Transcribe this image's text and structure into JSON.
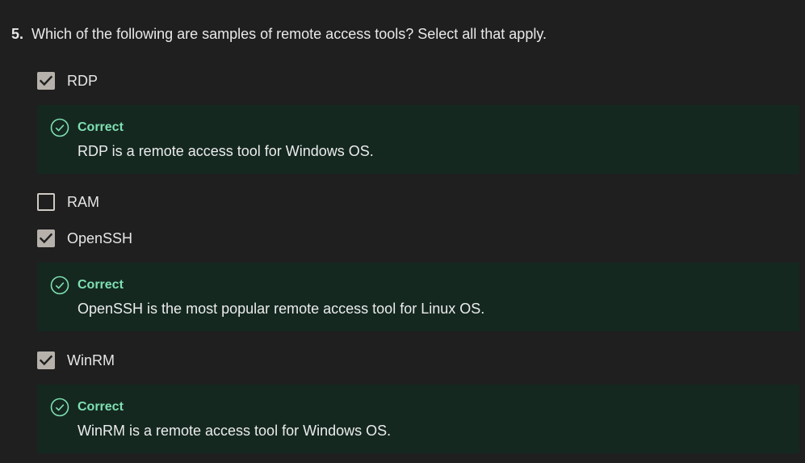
{
  "question": {
    "number": "5.",
    "text": "Which of the following are samples of remote access tools? Select all that apply."
  },
  "options": [
    {
      "label": "RDP",
      "checked": true,
      "feedback": {
        "status": "Correct",
        "text": "RDP is a remote access tool for Windows OS."
      }
    },
    {
      "label": "RAM",
      "checked": false
    },
    {
      "label": "OpenSSH",
      "checked": true,
      "feedback": {
        "status": "Correct",
        "text": "OpenSSH is the most popular remote access tool for Linux OS."
      }
    },
    {
      "label": "WinRM",
      "checked": true,
      "feedback": {
        "status": "Correct",
        "text": "WinRM is a remote access tool for Windows OS."
      }
    }
  ],
  "colors": {
    "background": "#1f1f1f",
    "feedback_background": "#142820",
    "correct_accent": "#7fe0b2",
    "checkbox_checked": "#b6b1aa"
  },
  "icons": {
    "checked_box": "checkbox-checked-icon",
    "unchecked_box": "checkbox-unchecked-icon",
    "correct": "check-circle-icon"
  }
}
